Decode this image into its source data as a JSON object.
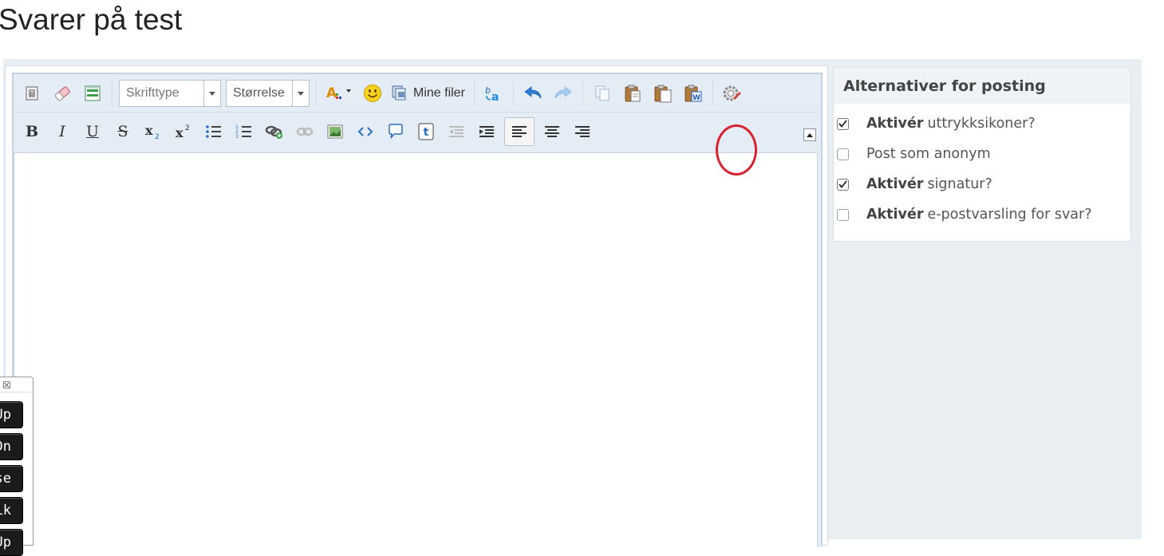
{
  "page": {
    "title": "Svarer på test"
  },
  "toolbar": {
    "font_select": {
      "value": "Skrifttype"
    },
    "size_select": {
      "value": "Størrelse"
    },
    "my_files_label": "Mine filer"
  },
  "options": {
    "header": "Alternativer for posting",
    "items": [
      {
        "bold": "Aktivér",
        "text": "uttrykksikoner?",
        "checked": true
      },
      {
        "bold": "",
        "text": "Post som anonym",
        "checked": false
      },
      {
        "bold": "Aktivér",
        "text": "signatur?",
        "checked": true
      },
      {
        "bold": "Aktivér",
        "text": "e-postvarsling for svar?",
        "checked": false
      }
    ]
  },
  "floating_panel": {
    "close_symbol": "☒",
    "keys": [
      "Up",
      "Dn",
      "use",
      "Lk",
      "Up"
    ]
  },
  "colors": {
    "highlight_circle": "#d8222e",
    "accent": "#1e88e5"
  }
}
